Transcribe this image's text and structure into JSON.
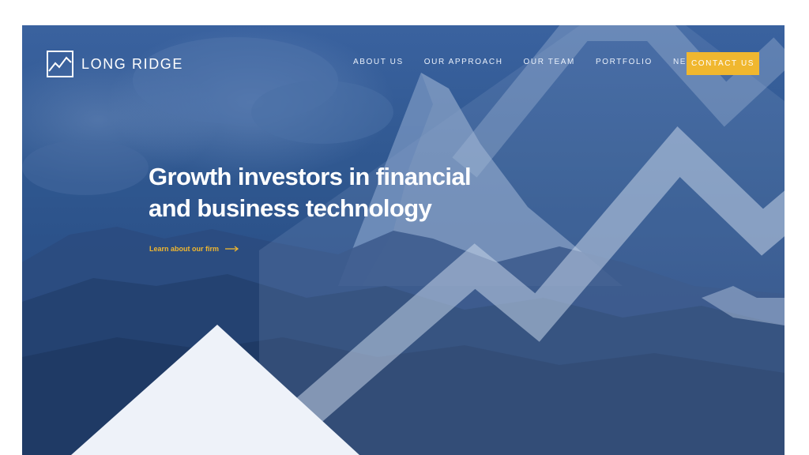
{
  "brand": {
    "name": "LONG RIDGE",
    "icon": "mountain-logo-icon",
    "accent_color": "#f0b72f",
    "hero_color": "#2f578f"
  },
  "nav": {
    "items": [
      {
        "label": "ABOUT US"
      },
      {
        "label": "OUR APPROACH"
      },
      {
        "label": "OUR TEAM"
      },
      {
        "label": "PORTFOLIO"
      },
      {
        "label": "NEWS"
      }
    ],
    "contact_label": "CONTACT US"
  },
  "hero": {
    "headline": "Growth investors in financial and business technology",
    "cta_label": "Learn about our firm",
    "cta_icon": "arrow-right-icon"
  }
}
